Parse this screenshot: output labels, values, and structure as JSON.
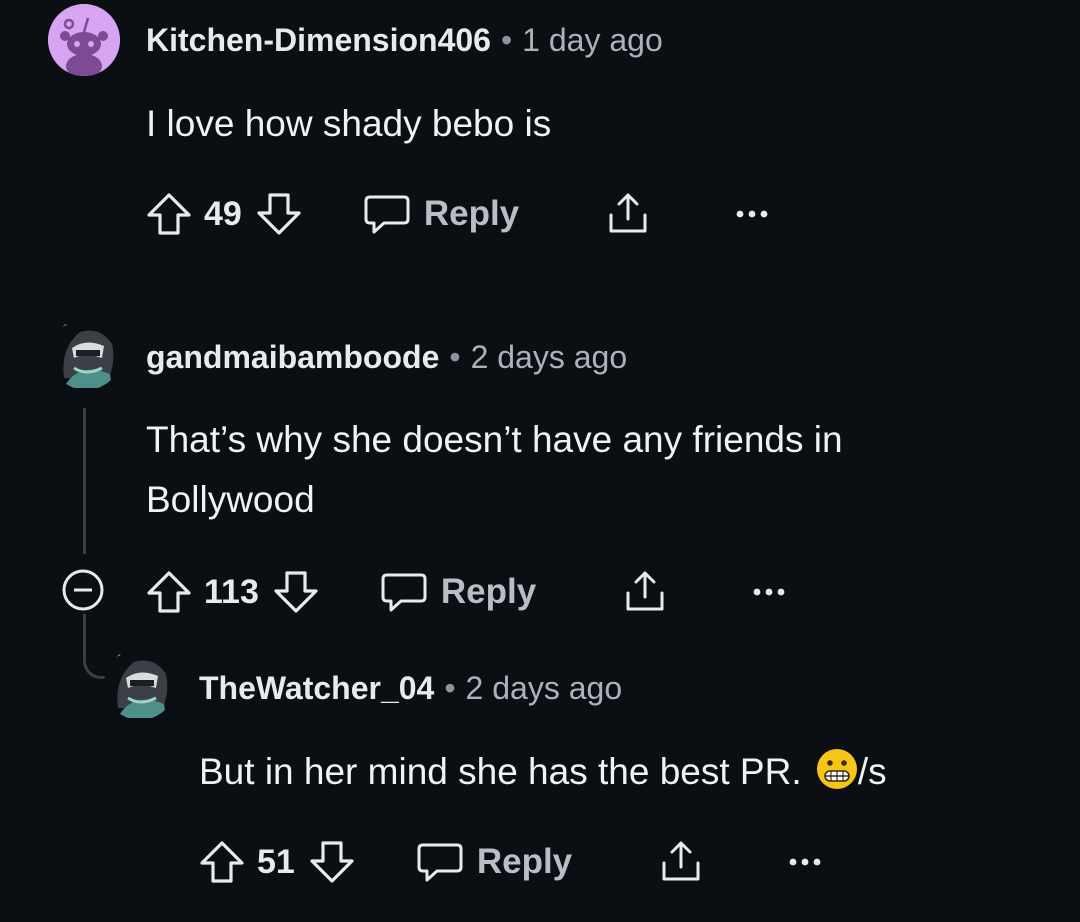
{
  "comments": [
    {
      "username": "Kitchen-Dimension406",
      "separator": "•",
      "time": "1 day ago",
      "body": "I love how shady bebo is",
      "votes": "49",
      "reply_label": "Reply",
      "avatar_icon": "reddit-snoo-avatar-icon",
      "avatar_color": "#d6a4f0"
    },
    {
      "username": "gandmaibamboode",
      "separator": "•",
      "time": "2 days ago",
      "body_line1": "That’s why she doesn’t have any friends in",
      "body_line2": "Bollywood",
      "votes": "113",
      "reply_label": "Reply",
      "avatar_icon": "custom-character-avatar-icon"
    },
    {
      "username": "TheWatcher_04",
      "separator": "•",
      "time": "2 days ago",
      "body": "But in her mind she has the best PR.",
      "emoji": "😬",
      "body_suffix": "/s",
      "votes": "51",
      "reply_label": "Reply",
      "avatar_icon": "custom-character-avatar-icon"
    }
  ],
  "colors": {
    "background": "#0b0f14",
    "text": "#e8eaed",
    "muted": "#aab2bb",
    "thread_line": "#3a3f45"
  }
}
